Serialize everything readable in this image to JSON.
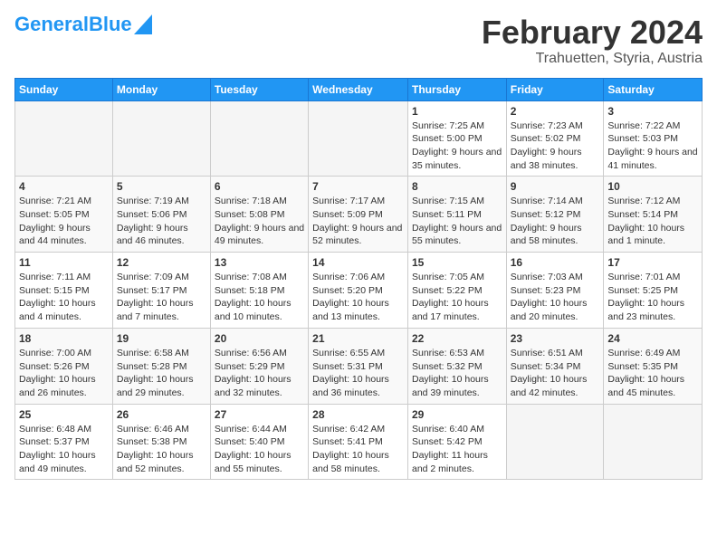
{
  "logo": {
    "part1": "General",
    "part2": "Blue"
  },
  "title": "February 2024",
  "subtitle": "Trahuetten, Styria, Austria",
  "headers": [
    "Sunday",
    "Monday",
    "Tuesday",
    "Wednesday",
    "Thursday",
    "Friday",
    "Saturday"
  ],
  "weeks": [
    [
      {
        "num": "",
        "sunrise": "",
        "sunset": "",
        "daylight": "",
        "empty": true
      },
      {
        "num": "",
        "sunrise": "",
        "sunset": "",
        "daylight": "",
        "empty": true
      },
      {
        "num": "",
        "sunrise": "",
        "sunset": "",
        "daylight": "",
        "empty": true
      },
      {
        "num": "",
        "sunrise": "",
        "sunset": "",
        "daylight": "",
        "empty": true
      },
      {
        "num": "1",
        "sunrise": "Sunrise: 7:25 AM",
        "sunset": "Sunset: 5:00 PM",
        "daylight": "Daylight: 9 hours and 35 minutes."
      },
      {
        "num": "2",
        "sunrise": "Sunrise: 7:23 AM",
        "sunset": "Sunset: 5:02 PM",
        "daylight": "Daylight: 9 hours and 38 minutes."
      },
      {
        "num": "3",
        "sunrise": "Sunrise: 7:22 AM",
        "sunset": "Sunset: 5:03 PM",
        "daylight": "Daylight: 9 hours and 41 minutes."
      }
    ],
    [
      {
        "num": "4",
        "sunrise": "Sunrise: 7:21 AM",
        "sunset": "Sunset: 5:05 PM",
        "daylight": "Daylight: 9 hours and 44 minutes."
      },
      {
        "num": "5",
        "sunrise": "Sunrise: 7:19 AM",
        "sunset": "Sunset: 5:06 PM",
        "daylight": "Daylight: 9 hours and 46 minutes."
      },
      {
        "num": "6",
        "sunrise": "Sunrise: 7:18 AM",
        "sunset": "Sunset: 5:08 PM",
        "daylight": "Daylight: 9 hours and 49 minutes."
      },
      {
        "num": "7",
        "sunrise": "Sunrise: 7:17 AM",
        "sunset": "Sunset: 5:09 PM",
        "daylight": "Daylight: 9 hours and 52 minutes."
      },
      {
        "num": "8",
        "sunrise": "Sunrise: 7:15 AM",
        "sunset": "Sunset: 5:11 PM",
        "daylight": "Daylight: 9 hours and 55 minutes."
      },
      {
        "num": "9",
        "sunrise": "Sunrise: 7:14 AM",
        "sunset": "Sunset: 5:12 PM",
        "daylight": "Daylight: 9 hours and 58 minutes."
      },
      {
        "num": "10",
        "sunrise": "Sunrise: 7:12 AM",
        "sunset": "Sunset: 5:14 PM",
        "daylight": "Daylight: 10 hours and 1 minute."
      }
    ],
    [
      {
        "num": "11",
        "sunrise": "Sunrise: 7:11 AM",
        "sunset": "Sunset: 5:15 PM",
        "daylight": "Daylight: 10 hours and 4 minutes."
      },
      {
        "num": "12",
        "sunrise": "Sunrise: 7:09 AM",
        "sunset": "Sunset: 5:17 PM",
        "daylight": "Daylight: 10 hours and 7 minutes."
      },
      {
        "num": "13",
        "sunrise": "Sunrise: 7:08 AM",
        "sunset": "Sunset: 5:18 PM",
        "daylight": "Daylight: 10 hours and 10 minutes."
      },
      {
        "num": "14",
        "sunrise": "Sunrise: 7:06 AM",
        "sunset": "Sunset: 5:20 PM",
        "daylight": "Daylight: 10 hours and 13 minutes."
      },
      {
        "num": "15",
        "sunrise": "Sunrise: 7:05 AM",
        "sunset": "Sunset: 5:22 PM",
        "daylight": "Daylight: 10 hours and 17 minutes."
      },
      {
        "num": "16",
        "sunrise": "Sunrise: 7:03 AM",
        "sunset": "Sunset: 5:23 PM",
        "daylight": "Daylight: 10 hours and 20 minutes."
      },
      {
        "num": "17",
        "sunrise": "Sunrise: 7:01 AM",
        "sunset": "Sunset: 5:25 PM",
        "daylight": "Daylight: 10 hours and 23 minutes."
      }
    ],
    [
      {
        "num": "18",
        "sunrise": "Sunrise: 7:00 AM",
        "sunset": "Sunset: 5:26 PM",
        "daylight": "Daylight: 10 hours and 26 minutes."
      },
      {
        "num": "19",
        "sunrise": "Sunrise: 6:58 AM",
        "sunset": "Sunset: 5:28 PM",
        "daylight": "Daylight: 10 hours and 29 minutes."
      },
      {
        "num": "20",
        "sunrise": "Sunrise: 6:56 AM",
        "sunset": "Sunset: 5:29 PM",
        "daylight": "Daylight: 10 hours and 32 minutes."
      },
      {
        "num": "21",
        "sunrise": "Sunrise: 6:55 AM",
        "sunset": "Sunset: 5:31 PM",
        "daylight": "Daylight: 10 hours and 36 minutes."
      },
      {
        "num": "22",
        "sunrise": "Sunrise: 6:53 AM",
        "sunset": "Sunset: 5:32 PM",
        "daylight": "Daylight: 10 hours and 39 minutes."
      },
      {
        "num": "23",
        "sunrise": "Sunrise: 6:51 AM",
        "sunset": "Sunset: 5:34 PM",
        "daylight": "Daylight: 10 hours and 42 minutes."
      },
      {
        "num": "24",
        "sunrise": "Sunrise: 6:49 AM",
        "sunset": "Sunset: 5:35 PM",
        "daylight": "Daylight: 10 hours and 45 minutes."
      }
    ],
    [
      {
        "num": "25",
        "sunrise": "Sunrise: 6:48 AM",
        "sunset": "Sunset: 5:37 PM",
        "daylight": "Daylight: 10 hours and 49 minutes."
      },
      {
        "num": "26",
        "sunrise": "Sunrise: 6:46 AM",
        "sunset": "Sunset: 5:38 PM",
        "daylight": "Daylight: 10 hours and 52 minutes."
      },
      {
        "num": "27",
        "sunrise": "Sunrise: 6:44 AM",
        "sunset": "Sunset: 5:40 PM",
        "daylight": "Daylight: 10 hours and 55 minutes."
      },
      {
        "num": "28",
        "sunrise": "Sunrise: 6:42 AM",
        "sunset": "Sunset: 5:41 PM",
        "daylight": "Daylight: 10 hours and 58 minutes."
      },
      {
        "num": "29",
        "sunrise": "Sunrise: 6:40 AM",
        "sunset": "Sunset: 5:42 PM",
        "daylight": "Daylight: 11 hours and 2 minutes."
      },
      {
        "num": "",
        "sunrise": "",
        "sunset": "",
        "daylight": "",
        "empty": true
      },
      {
        "num": "",
        "sunrise": "",
        "sunset": "",
        "daylight": "",
        "empty": true
      }
    ]
  ]
}
